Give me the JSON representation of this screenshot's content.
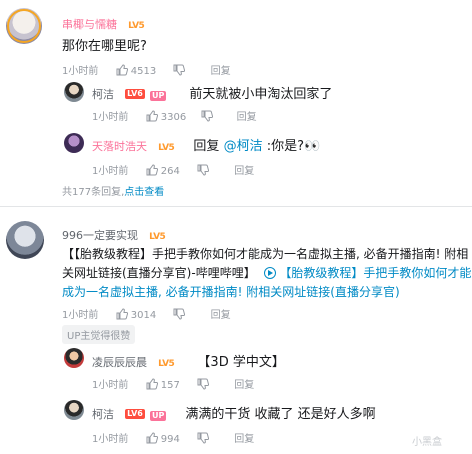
{
  "thread1": {
    "main": {
      "user": "串椰与懦糖",
      "level": "LV5",
      "text": "那你在哪里呢?",
      "time": "1小时前",
      "likes": "4513",
      "reply_label": "回复"
    },
    "replies": [
      {
        "user": "柯洁",
        "level": "LV6",
        "up_badge": "UP",
        "text": "前天就被小申淘汰回家了",
        "time": "1小时前",
        "likes": "3306",
        "reply_label": "回复"
      },
      {
        "user": "天落时浩天",
        "level": "LV5",
        "text_prefix": "回复",
        "mention": "@柯洁",
        "text_suffix": ":你是?",
        "emoji": "👀",
        "time": "1小时前",
        "likes": "264",
        "reply_label": "回复"
      }
    ],
    "summary_count": "共177条回复,",
    "summary_link": "点击查看"
  },
  "thread2": {
    "main": {
      "user": "996一定要实现",
      "level": "LV5",
      "line1_a": "【【胎教级教程】手把手教你如何才能成为一名虚拟主播, 必备开播指南! 附相",
      "line2_a": "关网址链接(直播分享官)-哔哩哔哩】",
      "line2_link": "【胎教级教程】手把手教你如何才能",
      "line3_link": "成为一名虚拟主播, 必备开播指南! 附相关网址链接(直播分享官)",
      "time": "1小时前",
      "likes": "3014",
      "reply_label": "回复",
      "up_liked": "UP主觉得很赞"
    },
    "replies": [
      {
        "user": "凌辰辰辰晨",
        "level": "LV5",
        "text": "【3D 学中文】",
        "time": "1小时前",
        "likes": "157",
        "reply_label": "回复"
      },
      {
        "user": "柯洁",
        "level": "LV6",
        "up_badge": "UP",
        "text": "满满的干货 收藏了 还是好人多啊",
        "time": "1小时前",
        "likes": "994",
        "reply_label": "回复"
      }
    ]
  },
  "watermark": "小黑盒",
  "colors": {
    "accent_pink": "#fb7299",
    "link_blue": "#008ac5",
    "meta_gray": "#9499a0",
    "level_orange": "#ff9a2e",
    "level_red": "#fe4d3e"
  },
  "icons": [
    "thumb-up-icon",
    "thumb-down-icon",
    "play-circle-icon",
    "avatar"
  ]
}
